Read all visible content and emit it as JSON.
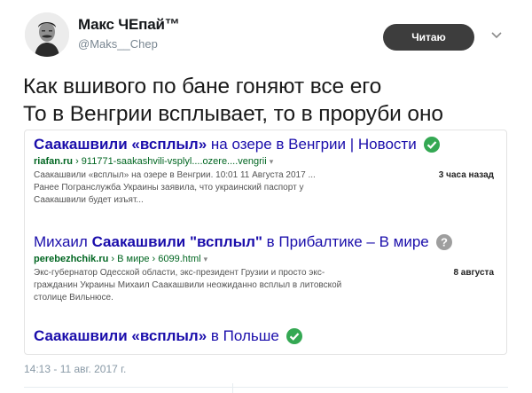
{
  "author": {
    "name": "Макс ЧЕпай™",
    "handle": "@Maks__Chep"
  },
  "follow_button": {
    "label": "Читаю"
  },
  "tweet_text": [
    "Как вшивого по бане гоняют все его",
    "То в Венгрии всплывает, то в проруби оно"
  ],
  "search_results": [
    {
      "title_parts": [
        "Саакашвили «всплыл»",
        " на озере в Венгрии | Новости"
      ],
      "url_domain": "riafan.ru",
      "url_path": " › 911771-saakashvili-vsplyl....ozere....vengrii",
      "snippet_lines": [
        "Саакашвили «всплыл» на озере в Венгрии. 10:01 11 Августа 2017 ...",
        "Ранее Погранслужба Украины заявила, что украинский паспорт у",
        "Саакашвили будет изъят..."
      ],
      "date": "3 часа назад",
      "badge": "check-circle-icon",
      "badge_color": "#34a853"
    },
    {
      "title_parts": [
        "Михаил ",
        "Саакашвили \"всплыл\"",
        " в Прибалтике – В мире"
      ],
      "url_domain": "perebezhchik.ru",
      "url_path": " › В мире › 6099.html",
      "snippet_lines": [
        "Экс-губернатор Одесской области, экс-президент Грузии и просто экс-",
        "гражданин Украины Михаил Саакашвили неожиданно всплыл в литовской",
        "столице Вильнюсе."
      ],
      "date": "8 августа",
      "badge": "question-circle-icon",
      "badge_color": "#9e9e9e"
    },
    {
      "title_parts": [
        "Саакашвили «всплыл»",
        " в Польше"
      ],
      "badge": "check-circle-icon",
      "badge_color": "#34a853"
    }
  ],
  "timestamp": "14:13 - 11 авг. 2017 г.",
  "colors": {
    "link": "#1a0dab",
    "url_green": "#006621",
    "button_bg": "#3d3d3d"
  }
}
